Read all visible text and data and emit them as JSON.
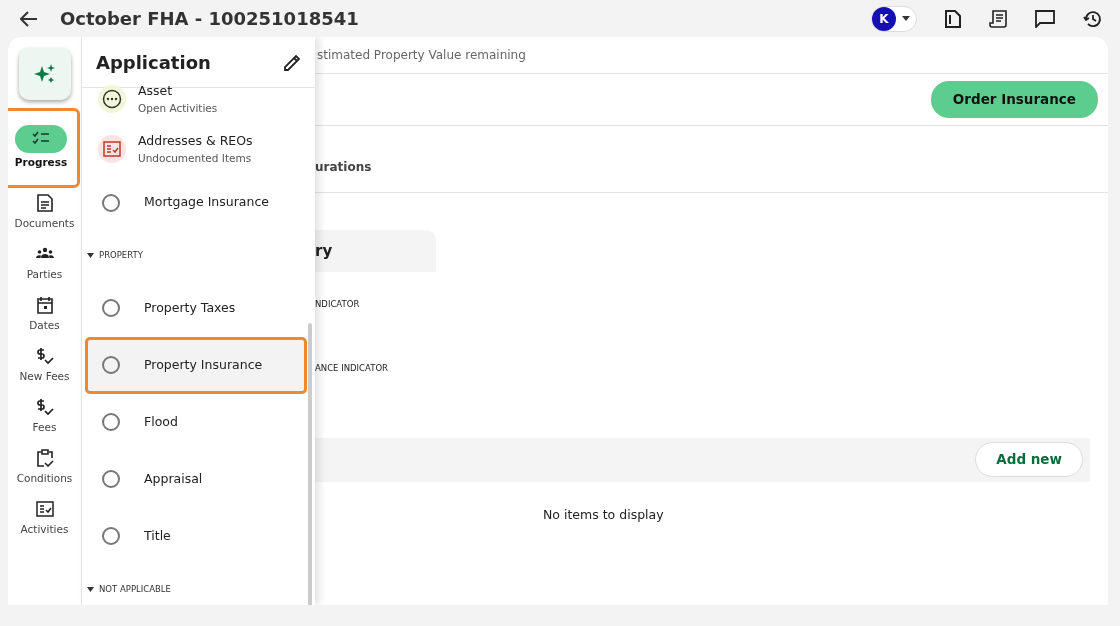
{
  "header": {
    "title": "October FHA - 100251018541",
    "avatar": "K"
  },
  "rail": {
    "items": [
      {
        "label": "Progress",
        "selected": true,
        "highlighted": true
      },
      {
        "label": "Documents",
        "selected": false,
        "highlighted": false
      },
      {
        "label": "Parties",
        "selected": false,
        "highlighted": false
      },
      {
        "label": "Dates",
        "selected": false,
        "highlighted": false
      },
      {
        "label": "New Fees",
        "selected": false,
        "highlighted": false
      },
      {
        "label": "Fees",
        "selected": false,
        "highlighted": false
      },
      {
        "label": "Conditions",
        "selected": false,
        "highlighted": false
      },
      {
        "label": "Activities",
        "selected": false,
        "highlighted": false
      }
    ]
  },
  "panel": {
    "title": "Application",
    "items": [
      {
        "kind": "status",
        "label": "Asset",
        "subtitle": "Open Activities",
        "color": "#f3f7d9",
        "highlighted": false
      },
      {
        "kind": "status",
        "label": "Addresses & REOs",
        "subtitle": "Undocumented Items",
        "color": "#fbe3e3",
        "highlighted": false
      },
      {
        "kind": "radio",
        "label": "Mortgage Insurance",
        "highlighted": false
      },
      {
        "kind": "section",
        "label": "PROPERTY",
        "expanded": true
      },
      {
        "kind": "radio",
        "label": "Property Taxes",
        "highlighted": false
      },
      {
        "kind": "radio",
        "label": "Property Insurance",
        "highlighted": true
      },
      {
        "kind": "radio",
        "label": "Flood",
        "highlighted": false
      },
      {
        "kind": "radio",
        "label": "Appraisal",
        "highlighted": false
      },
      {
        "kind": "radio",
        "label": "Title",
        "highlighted": false
      },
      {
        "kind": "section",
        "label": "NOT APPLICABLE",
        "expanded": true
      }
    ]
  },
  "content": {
    "notice": "stimated Property Value remaining",
    "order_button": "Order Insurance",
    "tab": "urations",
    "card_title": "ry",
    "field_1": "NDICATOR",
    "field_2": "ANCE INDICATOR",
    "add_button": "Add new",
    "empty": "No items to display"
  }
}
